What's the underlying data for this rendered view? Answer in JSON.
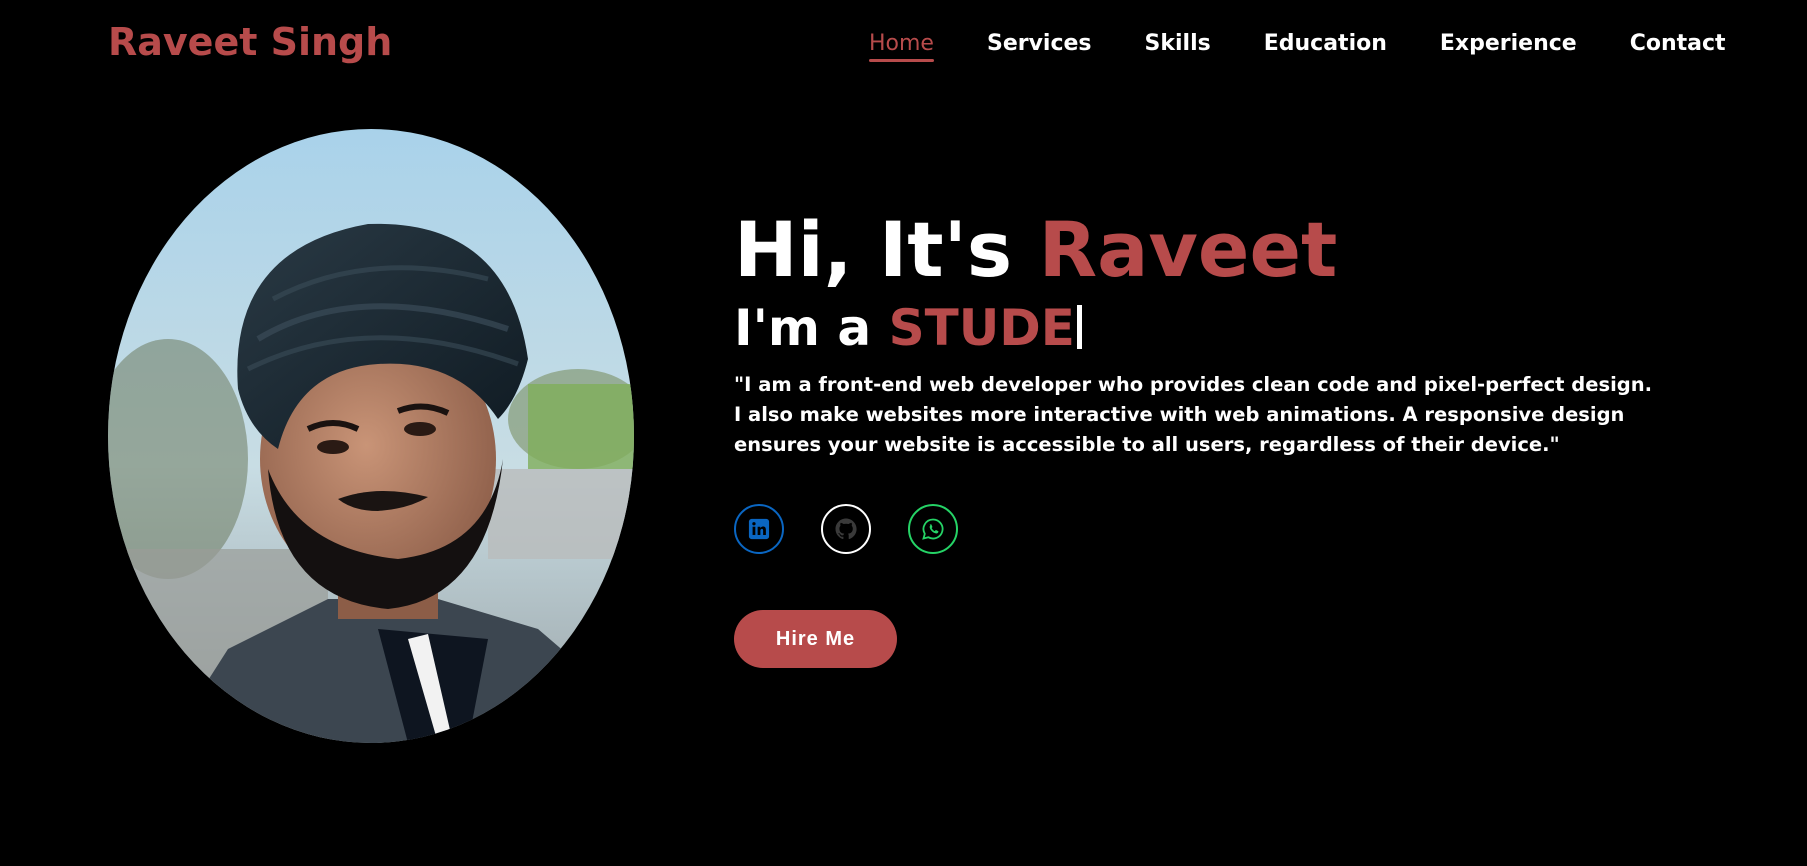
{
  "logo": "Raveet Singh",
  "nav": {
    "items": [
      {
        "label": "Home"
      },
      {
        "label": "Services"
      },
      {
        "label": "Skills"
      },
      {
        "label": "Education"
      },
      {
        "label": "Experience"
      },
      {
        "label": "Contact"
      }
    ]
  },
  "hero": {
    "greeting_prefix": "Hi, It's ",
    "greeting_name": "Raveet",
    "role_prefix": "I'm a ",
    "role_typed": "STUDE",
    "bio": "\"I am a front-end web developer who provides clean code and pixel-perfect design. I also make websites more interactive with web animations. A responsive design ensures your website is accessible to all users, regardless of their device.\"",
    "hire_label": "Hire Me"
  },
  "socials": [
    {
      "icon": "linkedin-icon"
    },
    {
      "icon": "github-icon"
    },
    {
      "icon": "whatsapp-icon"
    }
  ],
  "colors": {
    "background": "#000000",
    "accent": "#b74b4b",
    "text": "#ffffff",
    "linkedin": "#0a66c2",
    "whatsapp": "#25d366"
  }
}
